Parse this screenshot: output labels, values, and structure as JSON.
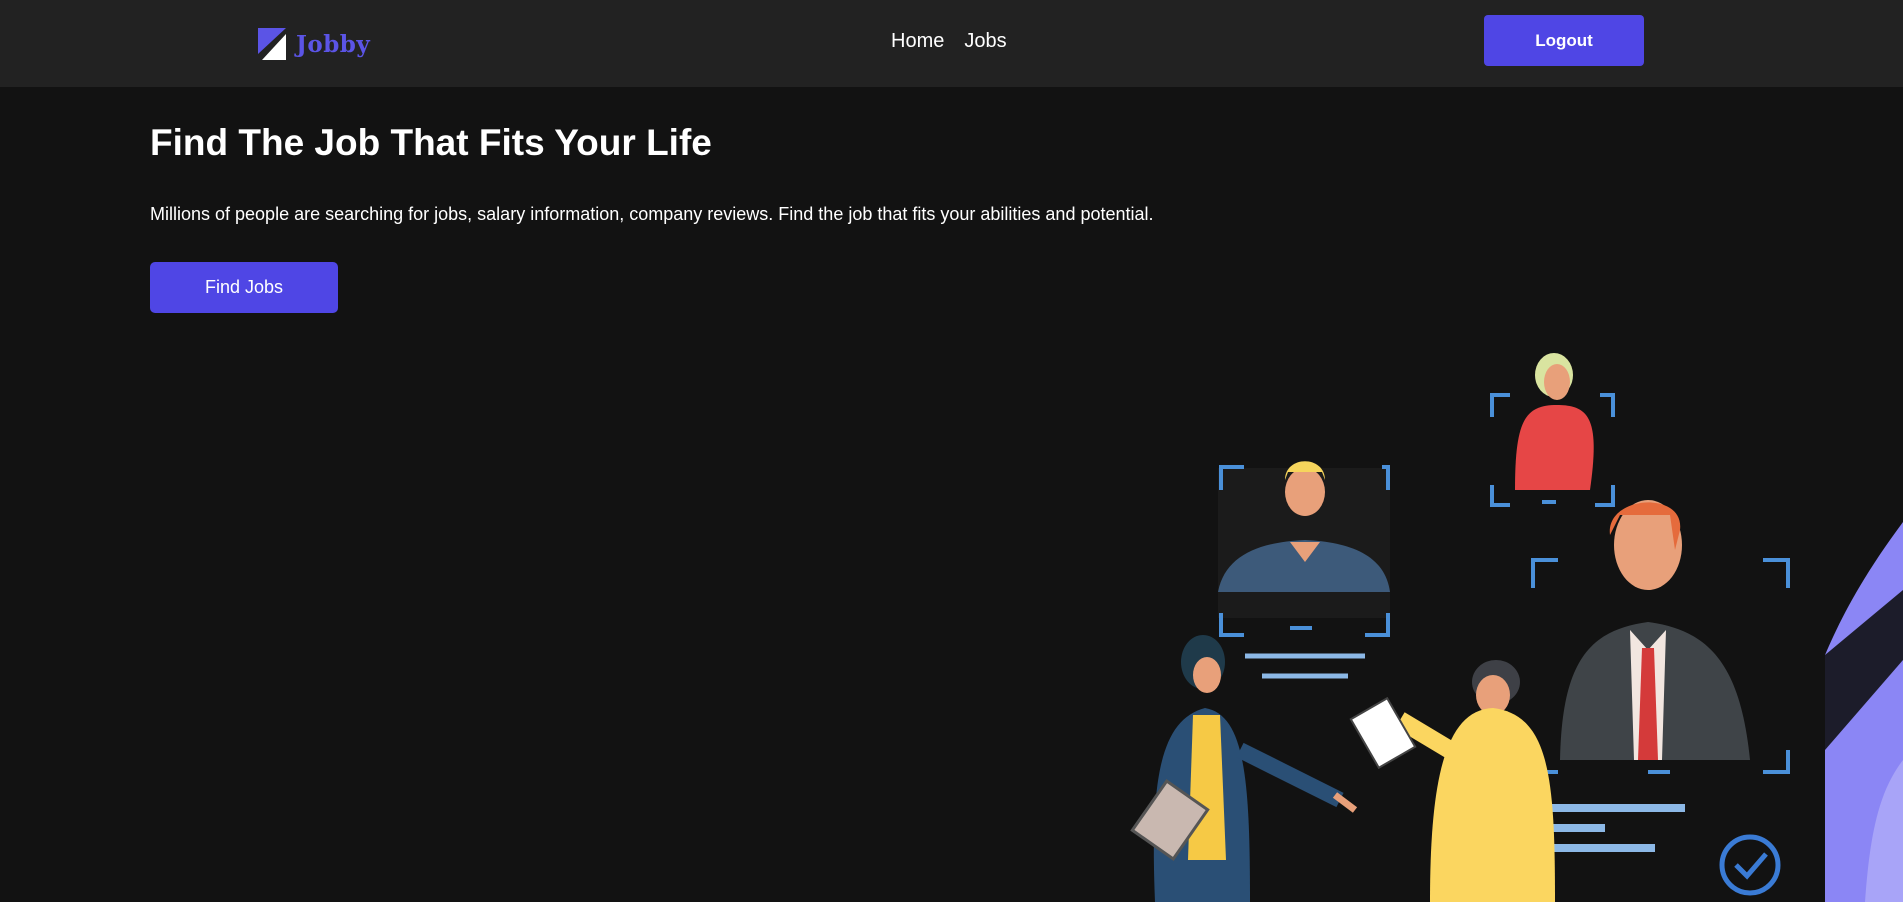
{
  "nav": {
    "brand": "Jobby",
    "links": [
      "Home",
      "Jobs"
    ],
    "logout_label": "Logout"
  },
  "hero": {
    "title": "Find The Job That Fits Your Life",
    "description": "Millions of people are searching for jobs, salary information, company reviews. Find the job that fits your abilities and potential.",
    "cta_label": "Find Jobs"
  },
  "colors": {
    "background": "#121212",
    "navbar": "#222222",
    "accent": "#4f46e5",
    "brand_text": "#5b54e6"
  },
  "icons": {
    "logo": "jobby-logo-icon",
    "illustration": "recruitment-illustration"
  }
}
